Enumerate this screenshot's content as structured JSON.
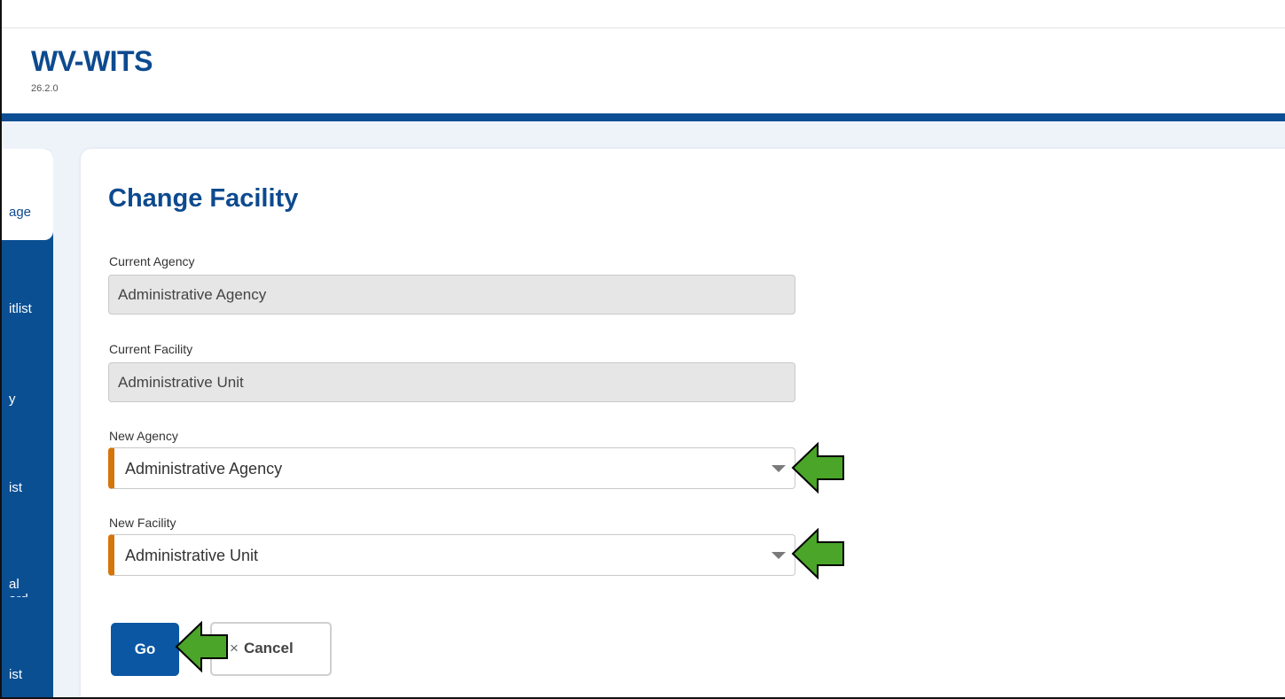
{
  "app": {
    "title": "WV-WITS",
    "version": "26.2.0"
  },
  "sidebar": {
    "items": [
      {
        "label": "age",
        "active": true
      },
      {
        "label": "itlist"
      },
      {
        "label": "y"
      },
      {
        "label": "ist"
      },
      {
        "label": "al\nard"
      },
      {
        "label": "ist"
      }
    ]
  },
  "page": {
    "title": "Change Facility"
  },
  "form": {
    "current_agency_label": "Current Agency",
    "current_agency_value": "Administrative Agency",
    "current_facility_label": "Current Facility",
    "current_facility_value": "Administrative Unit",
    "new_agency_label": "New Agency",
    "new_agency_value": "Administrative Agency",
    "new_facility_label": "New Facility",
    "new_facility_value": "Administrative Unit"
  },
  "buttons": {
    "go_label": "Go",
    "cancel_icon": "×",
    "cancel_label": "Cancel"
  },
  "annotations": {
    "arrow_color": "#4aa528",
    "arrow_outline": "#000000"
  },
  "colors": {
    "brand_blue": "#0d4a8f",
    "required_accent": "#d4760a",
    "primary_button": "#0b57a4"
  }
}
